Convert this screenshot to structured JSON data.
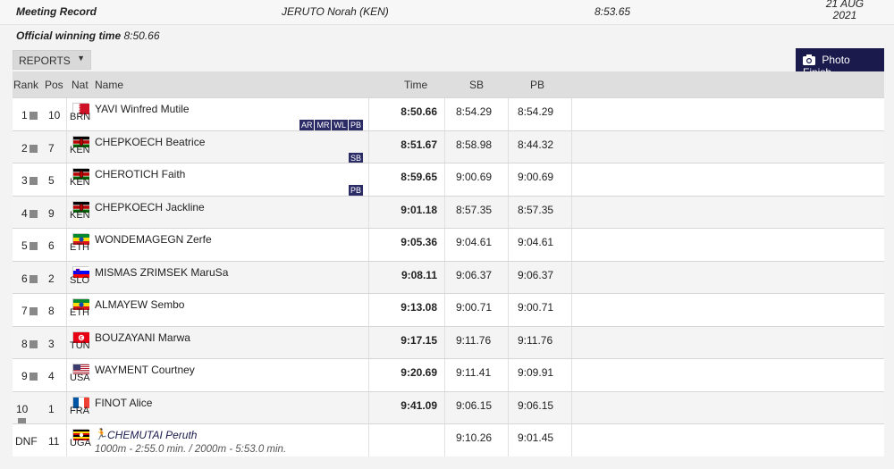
{
  "record": {
    "label": "Meeting Record",
    "holder": "JERUTO Norah (KEN)",
    "time": "8:53.65",
    "date_line1": "21 AUG",
    "date_line2": "2021"
  },
  "official": {
    "label": "Official winning time",
    "value": "8:50.66"
  },
  "reports_button": "REPORTS",
  "photo_finish_button": "Photo Finish",
  "headers": {
    "rank": "Rank",
    "pos": "Pos",
    "nat": "Nat",
    "name": "Name",
    "time": "Time",
    "sb": "SB",
    "pb": "PB"
  },
  "results": [
    {
      "rank": "1",
      "pos": "10",
      "nat": "BRN",
      "name": "YAVI Winfred Mutile",
      "time": "8:50.66",
      "sb": "8:54.29",
      "pb": "8:54.29",
      "badges": [
        "AR",
        "MR",
        "WL",
        "PB"
      ]
    },
    {
      "rank": "2",
      "pos": "7",
      "nat": "KEN",
      "name": "CHEPKOECH Beatrice",
      "time": "8:51.67",
      "sb": "8:58.98",
      "pb": "8:44.32",
      "badges": [
        "SB"
      ]
    },
    {
      "rank": "3",
      "pos": "5",
      "nat": "KEN",
      "name": "CHEROTICH Faith",
      "time": "8:59.65",
      "sb": "9:00.69",
      "pb": "9:00.69",
      "badges": [
        "PB"
      ]
    },
    {
      "rank": "4",
      "pos": "9",
      "nat": "KEN",
      "name": "CHEPKOECH Jackline",
      "time": "9:01.18",
      "sb": "8:57.35",
      "pb": "8:57.35",
      "badges": []
    },
    {
      "rank": "5",
      "pos": "6",
      "nat": "ETH",
      "name": "WONDEMAGEGN Zerfe",
      "time": "9:05.36",
      "sb": "9:04.61",
      "pb": "9:04.61",
      "badges": []
    },
    {
      "rank": "6",
      "pos": "2",
      "nat": "SLO",
      "name": "MISMAS ZRIMSEK MaruSa",
      "time": "9:08.11",
      "sb": "9:06.37",
      "pb": "9:06.37",
      "badges": []
    },
    {
      "rank": "7",
      "pos": "8",
      "nat": "ETH",
      "name": "ALMAYEW Sembo",
      "time": "9:13.08",
      "sb": "9:00.71",
      "pb": "9:00.71",
      "badges": []
    },
    {
      "rank": "8",
      "pos": "3",
      "nat": "TUN",
      "name": "BOUZAYANI Marwa",
      "time": "9:17.15",
      "sb": "9:11.76",
      "pb": "9:11.76",
      "badges": []
    },
    {
      "rank": "9",
      "pos": "4",
      "nat": "USA",
      "name": "WAYMENT Courtney",
      "time": "9:20.69",
      "sb": "9:11.41",
      "pb": "9:09.91",
      "badges": []
    },
    {
      "rank": "10",
      "pos": "1",
      "nat": "FRA",
      "name": "FINOT Alice",
      "time": "9:41.09",
      "sb": "9:06.15",
      "pb": "9:06.15",
      "badges": []
    }
  ],
  "dnf": {
    "rank": "DNF",
    "pos": "11",
    "nat": "UGA",
    "name": "CHEMUTAI Peruth",
    "split": "1000m - 2:55.0 min. / 2000m - 5:53.0 min.",
    "sb": "9:10.26",
    "pb": "9:01.45"
  }
}
